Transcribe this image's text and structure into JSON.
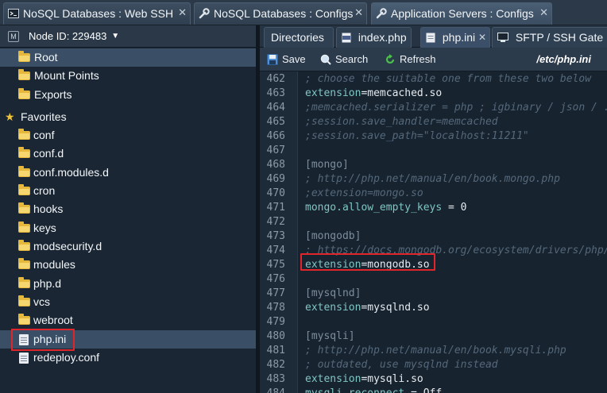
{
  "window_tabs": [
    {
      "label": "NoSQL Databases : Web SSH",
      "icon": "terminal-icon",
      "active": false
    },
    {
      "label": "NoSQL Databases : Configs",
      "icon": "wrench-icon",
      "active": false
    },
    {
      "label": "Application Servers : Configs",
      "icon": "wrench-icon",
      "active": true
    }
  ],
  "close_glyph": "✕",
  "node": {
    "label": "Node ID: 229483",
    "icon_letter": "M"
  },
  "tree": {
    "root": "Root",
    "mount_points": "Mount Points",
    "exports": "Exports",
    "favorites": "Favorites",
    "items": [
      "conf",
      "conf.d",
      "conf.modules.d",
      "cron",
      "hooks",
      "keys",
      "modsecurity.d",
      "modules",
      "php.d",
      "vcs",
      "webroot",
      "php.ini",
      "redeploy.conf"
    ]
  },
  "file_tabs": [
    {
      "label": "Directories",
      "icon": "none"
    },
    {
      "label": "index.php",
      "icon": "php-file-icon"
    },
    {
      "label": "php.ini",
      "icon": "file-icon",
      "active": true
    },
    {
      "label": "SFTP / SSH Gate",
      "icon": "monitor-icon"
    }
  ],
  "toolbar": {
    "save": "Save",
    "search": "Search",
    "refresh": "Refresh",
    "path": "/etc/php.ini"
  },
  "colors": {
    "highlight": "#e0262b",
    "folder": "#e5b83c",
    "accent_key": "#7fc7c2"
  },
  "code_lines": [
    {
      "n": "462",
      "type": "comment",
      "text": "; choose the suitable one from these two below"
    },
    {
      "n": "463",
      "type": "kv",
      "key": "extension",
      "val": "memcached.so"
    },
    {
      "n": "464",
      "type": "comment",
      "text": ";memcached.serializer = php ; igbinary / json / ..."
    },
    {
      "n": "465",
      "type": "comment",
      "text": ";session.save_handler=memcached"
    },
    {
      "n": "466",
      "type": "comment",
      "text": ";session.save_path=\"localhost:11211\""
    },
    {
      "n": "467",
      "type": "blank",
      "text": ""
    },
    {
      "n": "468",
      "type": "section",
      "text": "[mongo]"
    },
    {
      "n": "469",
      "type": "comment",
      "text": "; http://php.net/manual/en/book.mongo.php"
    },
    {
      "n": "470",
      "type": "comment",
      "text": ";extension=mongo.so"
    },
    {
      "n": "471",
      "type": "kv",
      "key": "mongo.allow_empty_keys",
      "val": " = 0"
    },
    {
      "n": "472",
      "type": "blank",
      "text": ""
    },
    {
      "n": "473",
      "type": "section",
      "text": "[mongodb]"
    },
    {
      "n": "474",
      "type": "comment",
      "text": "; https://docs.mongodb.org/ecosystem/drivers/php/"
    },
    {
      "n": "475",
      "type": "kv",
      "key": "extension",
      "val": "mongodb.so"
    },
    {
      "n": "476",
      "type": "blank",
      "text": ""
    },
    {
      "n": "477",
      "type": "section",
      "text": "[mysqlnd]"
    },
    {
      "n": "478",
      "type": "kv",
      "key": "extension",
      "val": "mysqlnd.so"
    },
    {
      "n": "479",
      "type": "blank",
      "text": ""
    },
    {
      "n": "480",
      "type": "section",
      "text": "[mysqli]"
    },
    {
      "n": "481",
      "type": "comment",
      "text": "; http://php.net/manual/en/book.mysqli.php"
    },
    {
      "n": "482",
      "type": "comment",
      "text": "; outdated, use mysqlnd instead"
    },
    {
      "n": "483",
      "type": "kv",
      "key": "extension",
      "val": "mysqli.so"
    },
    {
      "n": "484",
      "type": "kv",
      "key": "mysqli.reconnect",
      "val": " = Off"
    }
  ]
}
